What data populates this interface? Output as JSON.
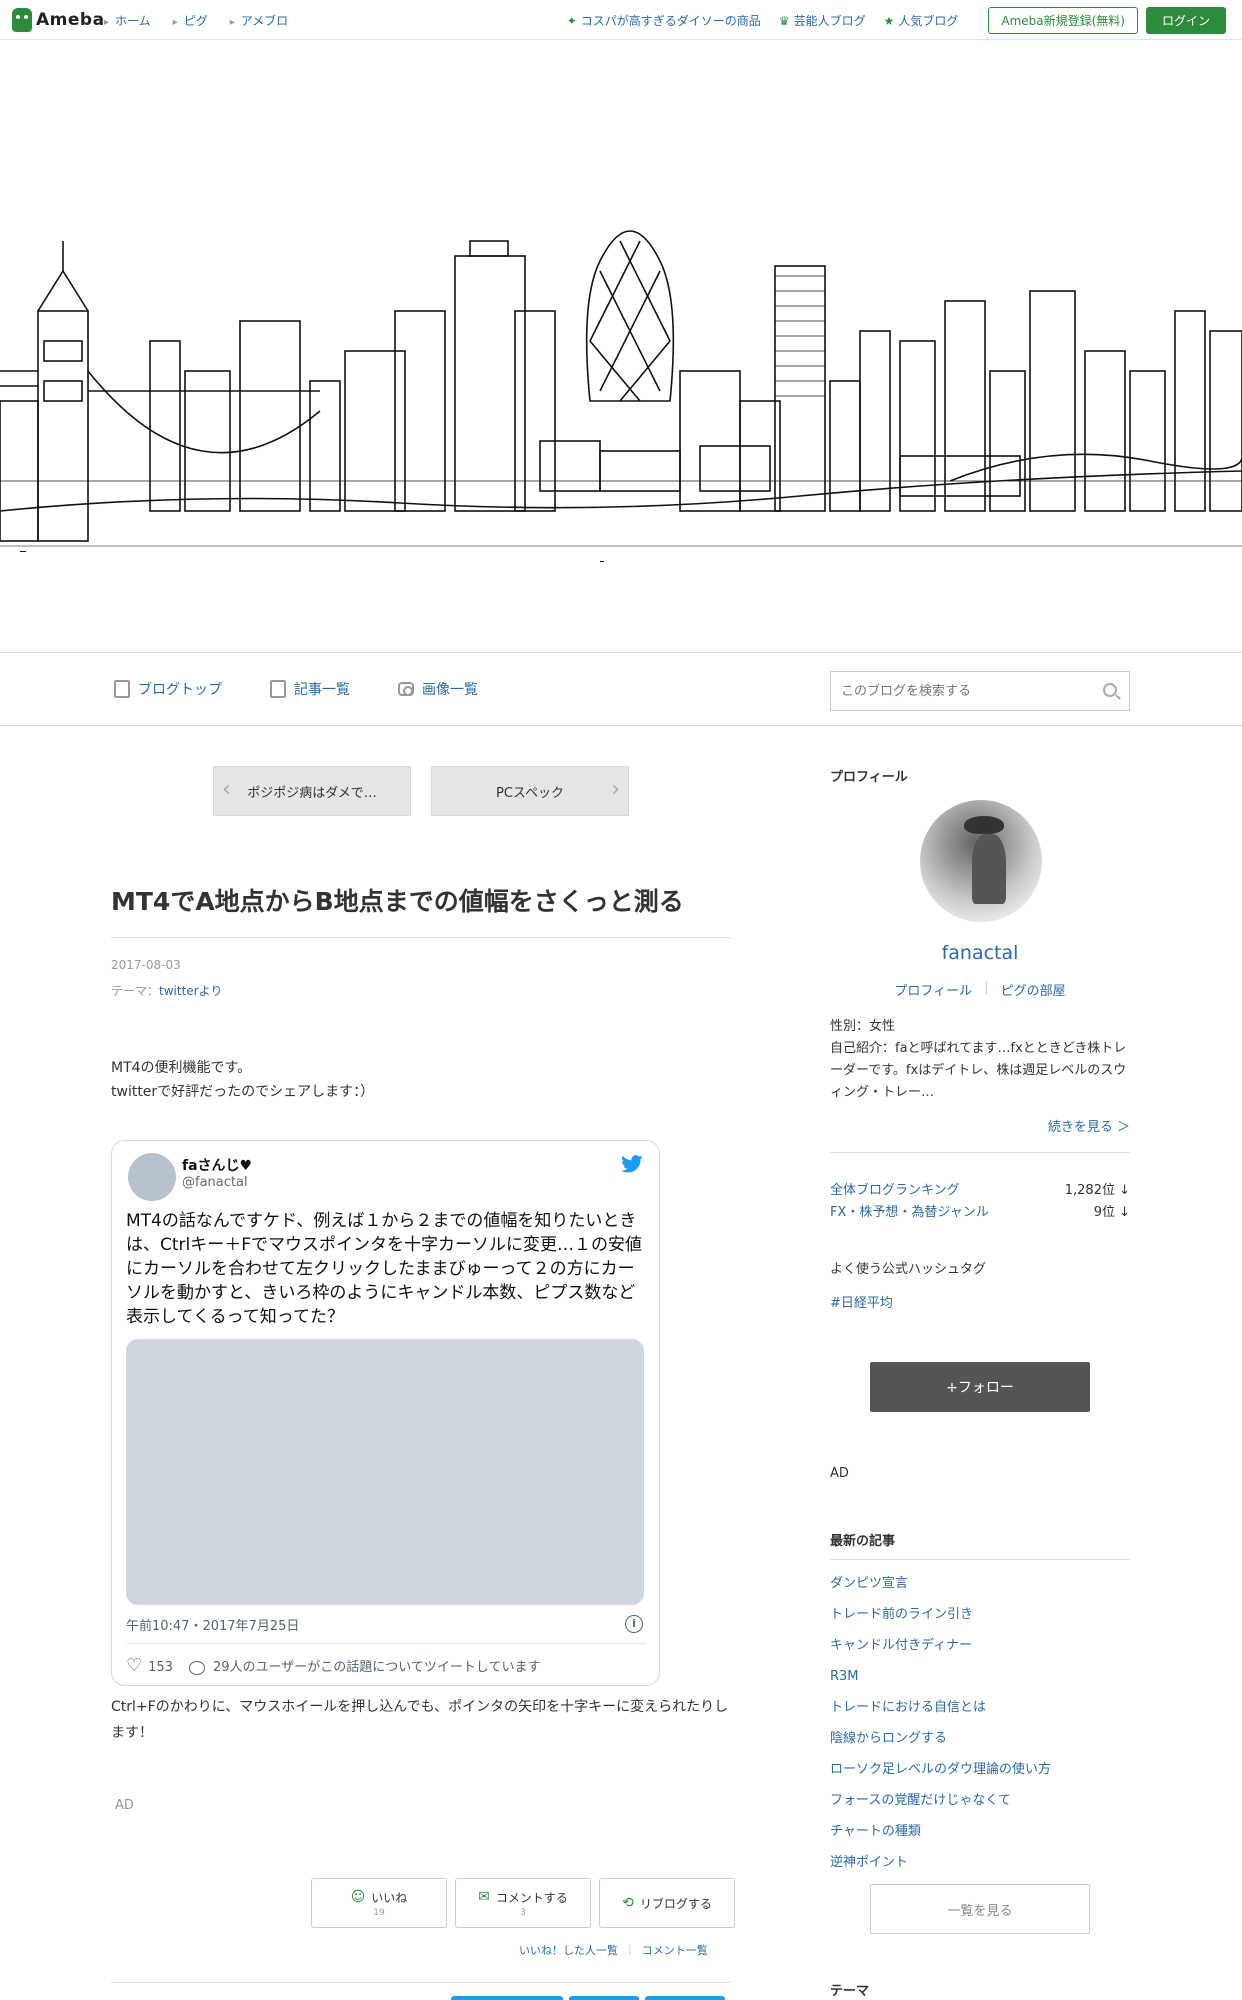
{
  "topbar": {
    "logo": "Ameba",
    "breadcrumbs": [
      "ホーム",
      "ピグ",
      "アメブロ"
    ],
    "links": [
      {
        "icon": "sparkle-icon",
        "label": "コスパが高すぎるダイソーの商品"
      },
      {
        "icon": "crown-icon",
        "label": "芸能人ブログ"
      },
      {
        "icon": "star-icon",
        "label": "人気ブログ"
      }
    ],
    "register_label": "Ameba新規登録(無料)",
    "login_label": "ログイン"
  },
  "blognav": {
    "items": [
      {
        "icon": "document-icon",
        "label": "ブログトップ"
      },
      {
        "icon": "copy-icon",
        "label": "記事一覧"
      },
      {
        "icon": "camera-icon",
        "label": "画像一覧"
      }
    ],
    "search_placeholder": "このブログを検索する"
  },
  "article": {
    "prev_label": "ポジポジ病はダメで…",
    "next_label": "PCスペック",
    "title": "MT4でA地点からB地点までの値幅をさくっと測る",
    "date": "2017-08-03",
    "theme_prefix": "テーマ：",
    "theme": "twitterより",
    "body_line1": "MT4の便利機能です。",
    "body_line2": "twitterで好評だったのでシェアします：）",
    "body_after": "Ctrl+Fのかわりに、マウスホイールを押し込んでも、ポインタの矢印を十字キーに変えられたりします！",
    "ad_label": "AD"
  },
  "tweet": {
    "name": "faさんじ♥",
    "handle": "@fanactal",
    "text": "MT4の話なんですケド、例えば１から２までの値幅を知りたいときは、Ctrlキー＋Fでマウスポインタを十字カーソルに変更…１の安値にカーソルを合わせて左クリックしたままびゅーって２の方にカーソルを動かすと、きいろ枠のようにキャンドル本数、ピプス数など表示してくるって知ってた？",
    "time": "午前10:47・2017年7月25日",
    "likes": "153",
    "replies_text": "29人のユーザーがこの話題についてツイートしています"
  },
  "actions": {
    "like_label": "いいね",
    "like_count": "19",
    "comment_label": "コメントする",
    "comment_count": "3",
    "reblog_label": "リブログする",
    "liked_list": "いいね！した人一覧",
    "comment_list": "コメント一覧"
  },
  "sidebar": {
    "profile_heading": "プロフィール",
    "name": "fanactal",
    "profile_link": "プロフィール",
    "pig_link": "ピグの部屋",
    "gender": "性別：女性",
    "intro": "自己紹介：faと呼ばれてます…fxとときどき株トレーダーです。fxはデイトレ、株は週足レベルのスウィング・トレー…",
    "more_label": "続きを見る ＞",
    "ranking": [
      {
        "label": "全体ブログランキング",
        "value": "1,282位 ↓"
      },
      {
        "label": "FX・株予想・為替ジャンル",
        "value": "9位 ↓"
      }
    ],
    "hashtag_heading": "よく使う公式ハッシュタグ",
    "hashtag": "#日経平均",
    "follow_label": "+フォロー",
    "ad_label": "AD",
    "recent_heading": "最新の記事",
    "recent": [
      "ダンピツ宣言",
      "トレード前のライン引き",
      "キャンドル付きディナー",
      "R3M",
      "トレードにおける自信とは",
      "陰線からロングする",
      "ローソク足レベルのダウ理論の使い方",
      "フォースの覚醒だけじゃなくて",
      "チャートの種類",
      "逆神ポイント"
    ],
    "see_all_label": "一覧を見る",
    "theme_heading": "テーマ"
  },
  "colors": {
    "accent": "#2d8c3c",
    "link": "#2b6aa8",
    "twitter": "#1d9bf0"
  }
}
